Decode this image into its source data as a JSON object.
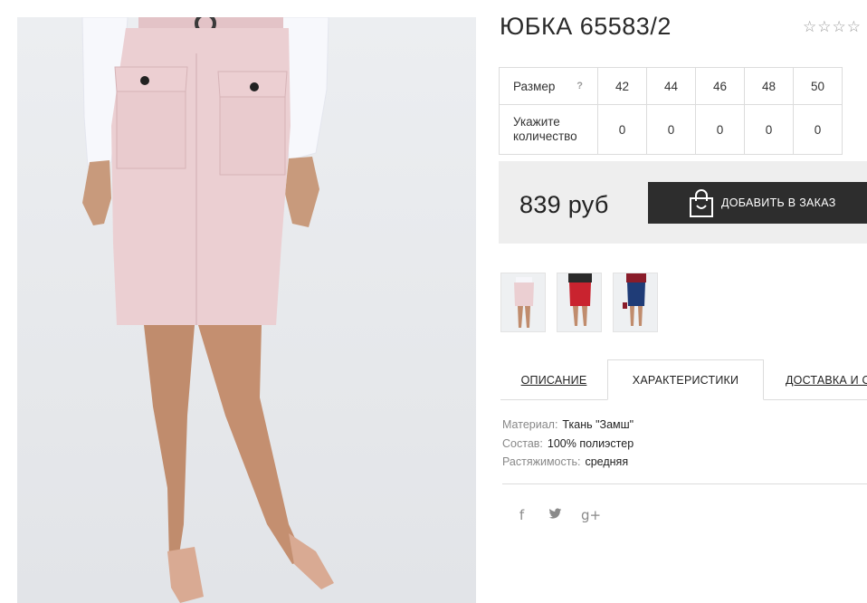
{
  "product": {
    "title": "ЮБКА 65583/2",
    "rating_max": 5
  },
  "size_table": {
    "size_label": "Размер",
    "help_icon": "?",
    "qty_label_line1": "Укажите",
    "qty_label_line2": "количество",
    "sizes": [
      "42",
      "44",
      "46",
      "48",
      "50"
    ],
    "quantities": [
      "0",
      "0",
      "0",
      "0",
      "0"
    ]
  },
  "buy": {
    "price": "839 руб",
    "add_to_cart_label": "ДОБАВИТЬ В ЗАКАЗ"
  },
  "tabs": {
    "description": "ОПИСАНИЕ",
    "characteristics": "ХАРАКТЕРИСТИКИ",
    "delivery": "ДОСТАВКА И ОПЛАТА"
  },
  "specs": {
    "material_key": "Материал:",
    "material_val": "Ткань \"Замш\"",
    "composition_key": "Состав:",
    "composition_val": "100% полиэстер",
    "stretch_key": "Растяжимость:",
    "stretch_val": "средняя"
  },
  "social": {
    "facebook": "f",
    "twitter": "twitter-icon",
    "googleplus": "g+"
  },
  "colors": {
    "skirt_pink": "#ebcfd2",
    "button_dark": "#2d2d2d",
    "box_bg": "#eeeeee",
    "thumb_red": "#c9232f",
    "thumb_blue": "#1f3c77"
  }
}
